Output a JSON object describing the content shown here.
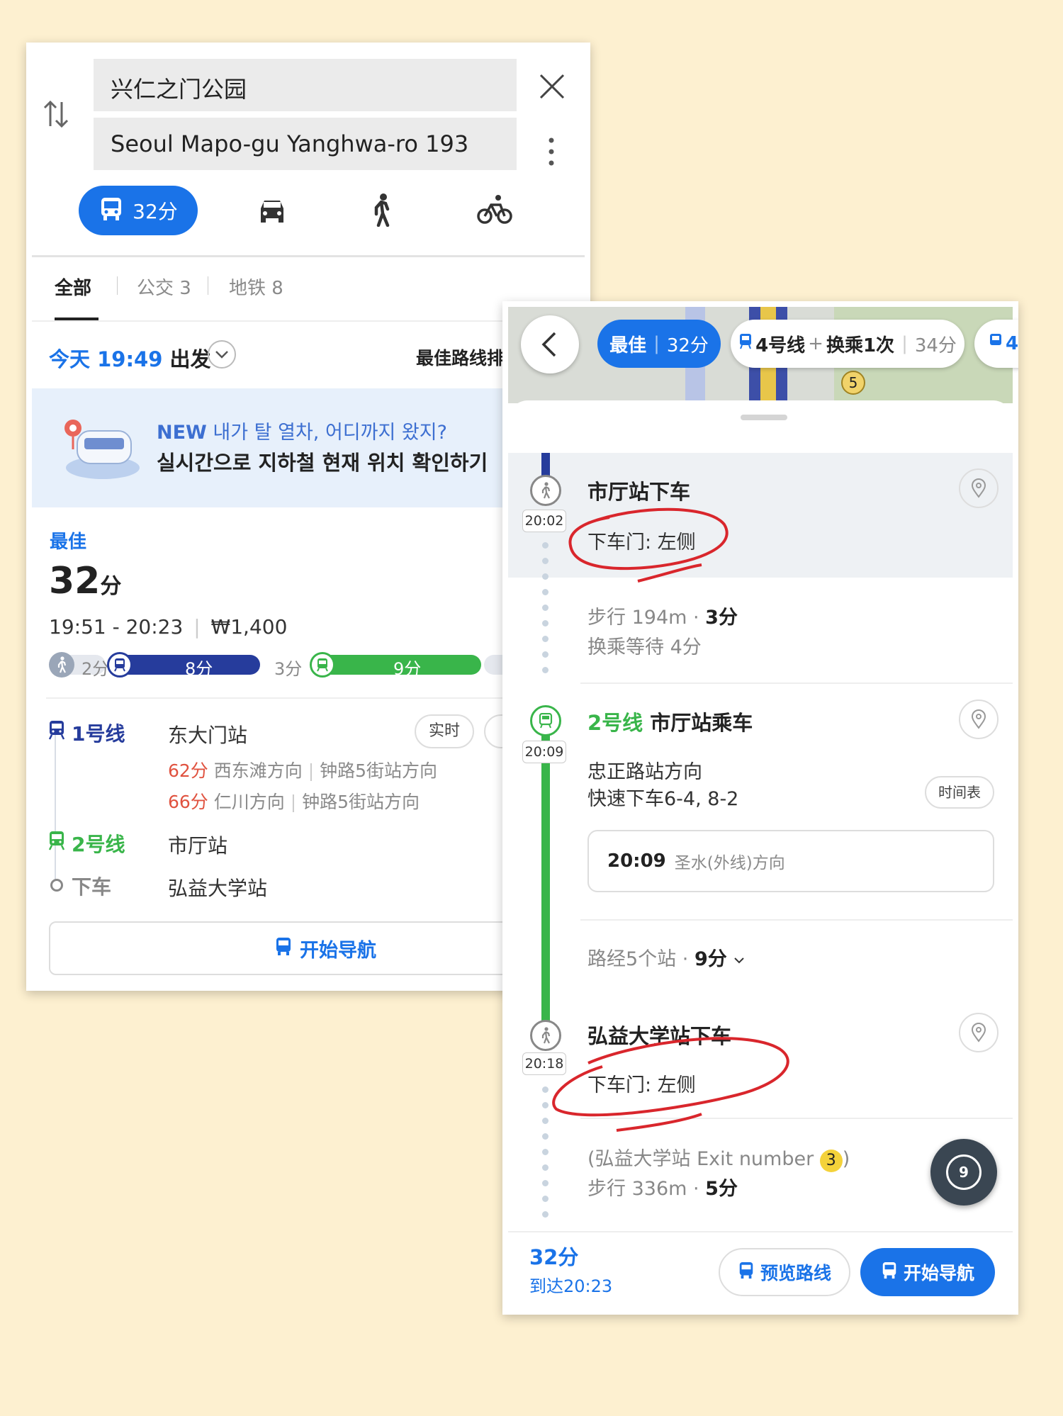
{
  "left": {
    "origin_field": "兴仁之门公园",
    "destination_field": "Seoul Mapo-gu Yanghwa-ro 193",
    "transit_mode_time": "32分",
    "tabs": [
      {
        "label": "全部"
      },
      {
        "label": "公交 3"
      },
      {
        "label": "地铁 8"
      }
    ],
    "depart_time": "今天 19:49",
    "depart_suffix": "出发",
    "sort_label": "最佳路线排",
    "banner": {
      "line1_new": "NEW",
      "line1_rest": "내가 탈 열차, 어디까지 왔지?",
      "line2": "실시간으로 지하철 현재 위치 확인하기"
    },
    "best_tag": "最佳",
    "duration_num": "32",
    "duration_unit": "分",
    "time_range": "19:51 - 20:23",
    "fare": "₩1,400",
    "progress": {
      "walk1": "2分",
      "line1_seg": "8分",
      "walk2": "3分",
      "line2_seg": "9分"
    },
    "route": {
      "line1_label": "1号线",
      "line1_station": "东大门站",
      "realtime_btn": "实时",
      "dep1_min": "62分",
      "dep1_dir": "西东滩方向",
      "dep1_dir2": "钟路5街站方向",
      "dep2_min": "66分",
      "dep2_dir": "仁川方向",
      "dep2_dir2": "钟路5街站方向",
      "line2_label": "2号线",
      "line2_station": "市厅站",
      "alight_label": "下车",
      "alight_station": "弘益大学站"
    },
    "start_nav": "开始导航"
  },
  "right": {
    "tabs": {
      "best": "最佳",
      "best_time": "32分",
      "alt_line": "4号线",
      "alt_plus": "+",
      "alt_transfer": "换乘1次",
      "alt_time": "34分",
      "third": "4"
    },
    "map_badge": "5",
    "step1": {
      "time": "20:02",
      "title": "市厅站下车",
      "door": "下车门: 左侧"
    },
    "walk1": {
      "text": "步行 194m",
      "min": "3分",
      "wait": "换乘等待 4分"
    },
    "step2": {
      "time": "20:09",
      "line": "2号线",
      "title": "市厅站乘车",
      "dir": "忠正路站方向",
      "exit": "快速下车6-4, 8-2",
      "timetable": "时间表",
      "next_time": "20:09",
      "next_dir": "圣水(外线)方向",
      "via": "路经5个站",
      "via_min": "9分"
    },
    "step3": {
      "time": "20:18",
      "title": "弘益大学站下车",
      "door": "下车门: 左侧"
    },
    "exit_info": {
      "prefix": "(弘益大学站 Exit number",
      "num": "3",
      "suffix": ")"
    },
    "walk2": {
      "text": "步行 336m",
      "min": "5分"
    },
    "float_num": "9",
    "footer": {
      "total": "32分",
      "arrive": "到达20:23",
      "preview": "预览路线",
      "start": "开始导航"
    }
  },
  "colors": {
    "accent": "#1a73e8",
    "line1": "#263c9c",
    "line2": "#39b54a",
    "depart_red": "#e0523f",
    "annotation": "#d9262c"
  }
}
